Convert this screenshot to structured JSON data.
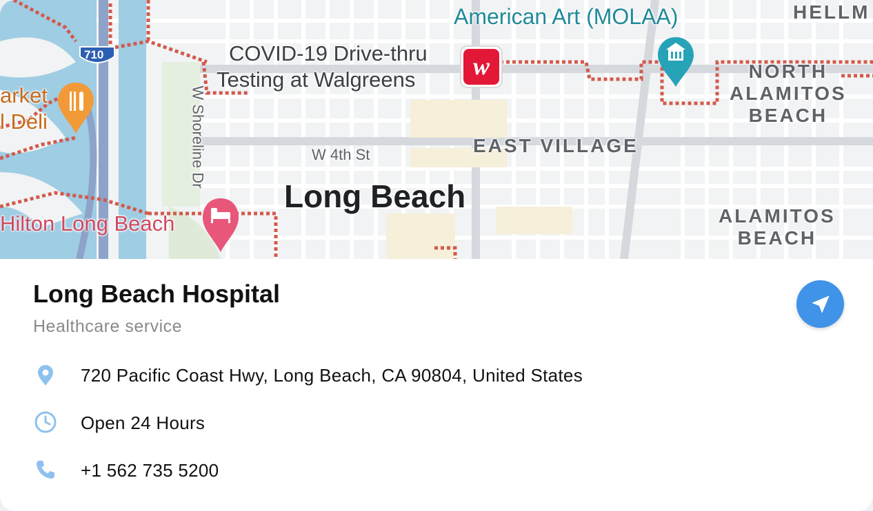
{
  "map": {
    "labels": {
      "molaa": "American Art (MOLAA)",
      "hellm": "HELLM",
      "covid_line1": "COVID-19 Drive-thru",
      "covid_line2": "Testing at Walgreens",
      "market_line1": "arket",
      "market_line2": "l Deli",
      "shoreline": "W Shoreline Dr",
      "w4th": "W 4th St",
      "east_village": "EAST VILLAGE",
      "long_beach": "Long Beach",
      "hilton": "Hilton Long Beach",
      "north_alamitos_1": "NORTH",
      "north_alamitos_2": "ALAMITOS",
      "north_alamitos_3": "BEACH",
      "alamitos_1": "ALAMITOS",
      "alamitos_2": "BEACH",
      "highway_shield": "710"
    },
    "icons": {
      "walgreens": "walgreens-logo",
      "museum": "museum-pin",
      "restaurant": "restaurant-pin",
      "hotel": "hotel-pin"
    }
  },
  "place": {
    "name": "Long Beach Hospital",
    "category": "Healthcare service",
    "address": "720 Pacific Coast Hwy, Long Beach, CA 90804, United States",
    "hours": "Open 24 Hours",
    "phone": "+1 562 735 5200"
  },
  "colors": {
    "accent": "#3f93e8",
    "icon_blue": "#8ec1ee"
  }
}
